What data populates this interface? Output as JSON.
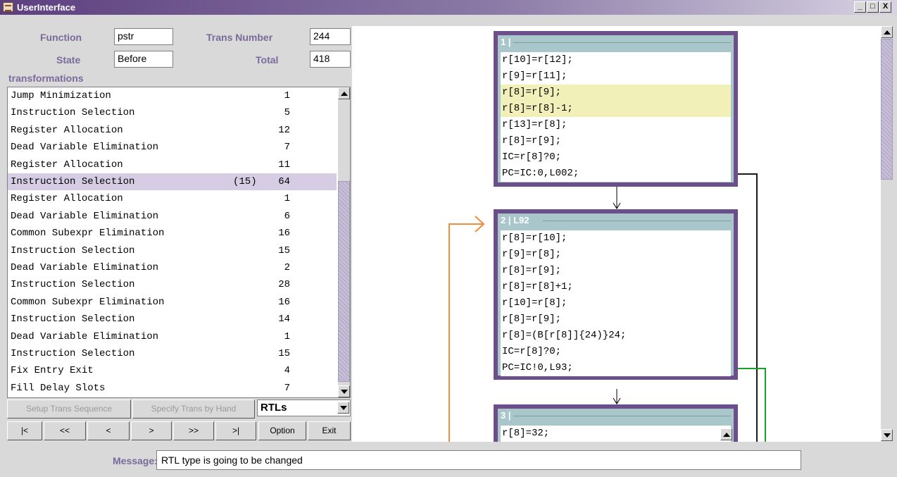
{
  "window": {
    "title": "UserInterface",
    "minimize": "_",
    "maximize": "□",
    "close": "X"
  },
  "header": {
    "function_label": "Function",
    "function_value": "pstr",
    "trans_number_label": "Trans Number",
    "trans_number_value": "244",
    "state_label": "State",
    "state_value": "Before",
    "total_label": "Total",
    "total_value": "418"
  },
  "transformations": {
    "label": "transformations",
    "rows": [
      {
        "name": "Jump Minimization",
        "count": "1",
        "note": ""
      },
      {
        "name": "Instruction Selection",
        "count": "5",
        "note": ""
      },
      {
        "name": "Register Allocation",
        "count": "12",
        "note": ""
      },
      {
        "name": "Dead Variable Elimination",
        "count": "7",
        "note": ""
      },
      {
        "name": "Register Allocation",
        "count": "11",
        "note": ""
      },
      {
        "name": "Instruction Selection",
        "count": "64",
        "note": "(15)"
      },
      {
        "name": "Register Allocation",
        "count": "1",
        "note": ""
      },
      {
        "name": "Dead Variable Elimination",
        "count": "6",
        "note": ""
      },
      {
        "name": "Common Subexpr Elimination",
        "count": "16",
        "note": ""
      },
      {
        "name": "Instruction Selection",
        "count": "15",
        "note": ""
      },
      {
        "name": "Dead Variable Elimination",
        "count": "2",
        "note": ""
      },
      {
        "name": "Instruction Selection",
        "count": "28",
        "note": ""
      },
      {
        "name": "Common Subexpr Elimination",
        "count": "16",
        "note": ""
      },
      {
        "name": "Instruction Selection",
        "count": "14",
        "note": ""
      },
      {
        "name": "Dead Variable Elimination",
        "count": "1",
        "note": ""
      },
      {
        "name": "Instruction Selection",
        "count": "15",
        "note": ""
      },
      {
        "name": "Fix Entry Exit",
        "count": "4",
        "note": ""
      },
      {
        "name": "Fill Delay Slots",
        "count": "7",
        "note": ""
      }
    ]
  },
  "controls": {
    "setup_trans_sequence": "Setup Trans Sequence",
    "specify_trans_by_hand": "Specify Trans by Hand",
    "view_select": "RTLs",
    "first": "|<",
    "rewind": "<<",
    "back": "<",
    "forward": ">",
    "fast_forward": ">>",
    "last": ">|",
    "option": "Option",
    "exit": "Exit"
  },
  "blocks": [
    {
      "header": "1 |",
      "lines": [
        "r[10]=r[12];",
        "r[9]=r[11];",
        "r[8]=r[9];",
        "r[8]=r[8]-1;",
        "r[13]=r[8];",
        "r[8]=r[9];",
        "IC=r[8]?0;",
        "PC=IC:0,L002;"
      ],
      "highlight": [
        2,
        3
      ]
    },
    {
      "header": "2  |  L92",
      "lines": [
        "r[8]=r[10];",
        "r[9]=r[8];",
        "r[8]=r[9];",
        "r[8]=r[8]+1;",
        "r[10]=r[8];",
        "r[8]=r[9];",
        "r[8]=(B[r[8]]{24)}24;",
        "IC=r[8]?0;",
        "PC=IC!0,L93;"
      ],
      "highlight": []
    },
    {
      "header": "3 |",
      "lines": [
        "r[8]=32;"
      ],
      "highlight": []
    }
  ],
  "colors": {
    "block_border": "#6b4e8a",
    "block_header": "#a9c7ca",
    "highlight": "#f0f0b8",
    "selected_row": "#d6cde4",
    "loop_edge": "#f08c3c",
    "exit_edge_green": "#1aa02a",
    "exit_edge_black": "#1a1a1a"
  },
  "message": {
    "label": "Message:",
    "text": "RTL type is going to be changed"
  }
}
